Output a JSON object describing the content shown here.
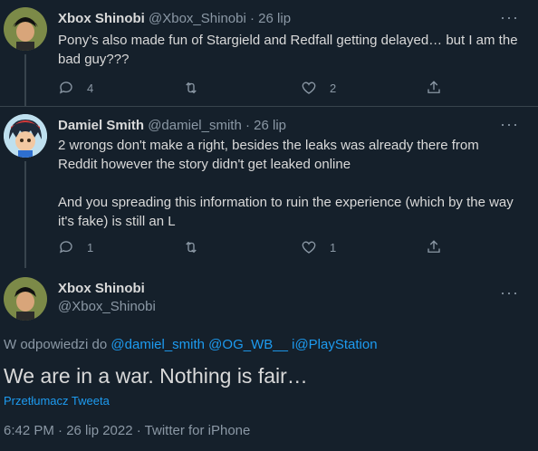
{
  "tweets": [
    {
      "name": "Xbox Shinobi",
      "handle": "@Xbox_Shinobi",
      "dot": "·",
      "time": "26 lip",
      "text_lines": [
        "Pony’s also made fun of Stargield and Redfall getting delayed… but I am the",
        "bad guy???"
      ],
      "reply_count": "4",
      "like_count": "2",
      "more_icon": "more-icon"
    },
    {
      "name": "Damiel Smith",
      "handle": "@damiel_smith",
      "dot": "·",
      "time": "26 lip",
      "text_lines": [
        "2 wrongs don't make a right, besides the leaks was already there from",
        "Reddit however the story didn't get leaked online",
        "",
        "And you spreading this information to ruin the experience (which by the way",
        "it's fake) is still an L"
      ],
      "reply_count": "1",
      "like_count": "1",
      "more_icon": "more-icon"
    }
  ],
  "main_tweet": {
    "name": "Xbox Shinobi",
    "handle": "@Xbox_Shinobi",
    "reply_prefix": "W odpowiedzi do",
    "reply_mention_1": "@damiel_smith",
    "reply_mention_2": "@OG_WB__",
    "reply_mention_3": "i@PlayStation",
    "text": "We are in a war. Nothing is fair…",
    "translate_label": "Przetłumacz Tweeta",
    "meta": "6:42 PM · 26 lip 2022 · Twitter for iPhone"
  },
  "colors": {
    "background": "#15202b",
    "text": "#d9d9d9",
    "secondary": "#8b98a5",
    "accent": "#1d9bf0",
    "border": "#38444d"
  }
}
